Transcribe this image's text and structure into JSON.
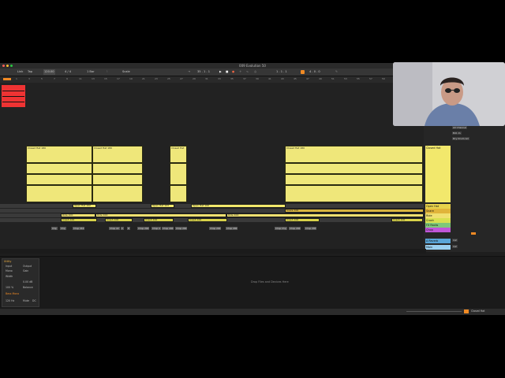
{
  "window": {
    "title": "009 Evolution 50"
  },
  "transport": {
    "link": "Link",
    "tap": "Tap",
    "tempo": "120.00",
    "time_sig": "4 / 4",
    "bars": "1 Bar",
    "key": "Scale",
    "position": "35 . 1 . 1",
    "loop_start": "1 . 1 . 1",
    "loop_len": "4 . 0 . 0"
  },
  "ruler": {
    "ticks": [
      "1",
      "3",
      "5",
      "7",
      "9",
      "11",
      "13",
      "15",
      "17",
      "19",
      "21",
      "23",
      "25",
      "27",
      "29",
      "31",
      "33",
      "35",
      "37",
      "39",
      "41",
      "43",
      "45",
      "47",
      "49",
      "51",
      "53",
      "55",
      "57",
      "59",
      "61",
      "63",
      "65"
    ]
  },
  "clips": [
    {
      "name": "Closed Hat 180"
    },
    {
      "name": "Closed Hat 180"
    },
    {
      "name": "Closed Hat"
    },
    {
      "name": "Closed Hat 180"
    }
  ],
  "lanes": {
    "open_hat": [
      "Open Hat 102",
      "Open Hat 103",
      "Open Hat 100"
    ],
    "snare": [
      "Snare 100"
    ],
    "ride": [
      "Ride 100",
      "Ride 100",
      "Ride 100"
    ],
    "crash": [
      "Crash 100",
      "Crash 100",
      "Crash 100",
      "Crash 100",
      "Crash 100",
      "Crash 100"
    ],
    "chops": [
      "Chp",
      "Chp",
      "Chop 210",
      "Chop 22",
      "C",
      "D",
      "Chop 200",
      "Chop 2",
      "Chop 200",
      "Chop 200",
      "Chop 200",
      "Chop 200",
      "Chop 200",
      "Chp",
      "Chop 200",
      "Chop 200",
      "Chop 200"
    ]
  },
  "mixer": {
    "top_controls": [
      "All Channel",
      "Ext. In",
      "Dry Drum Ad"
    ],
    "tracks": [
      {
        "name": "Closed Hat",
        "color": "#f2e86c"
      },
      {
        "name": "Open Hat",
        "color": "#e8d24a"
      },
      {
        "name": "Snare",
        "color": "#e0b43a"
      },
      {
        "name": "Ride",
        "color": "#f0e070"
      },
      {
        "name": "Crash",
        "color": "#d8e050"
      },
      {
        "name": "FX Racks",
        "color": "#7ec87a"
      },
      {
        "name": "Chop",
        "color": "#c056d8"
      },
      {
        "name": "A Reverb",
        "color": "#5aa6d8"
      },
      {
        "name": "Main",
        "color": "#9ad0f0"
      }
    ],
    "sends": [
      "1/2",
      "1/2"
    ]
  },
  "bottom": {
    "drop_hint": "Drop Files and Devices Here",
    "status_right": "Closed Hat"
  },
  "device": {
    "title": "Utility",
    "labels": [
      "Input",
      "Output",
      "Mono",
      "Gain",
      "Width",
      "0.00 dB",
      "100 %",
      "Balance",
      "Bass Mono",
      "120 Hz",
      "Mute",
      "DC"
    ]
  },
  "colors": {
    "clip": "#efe77a",
    "accent": "#f08a24"
  }
}
